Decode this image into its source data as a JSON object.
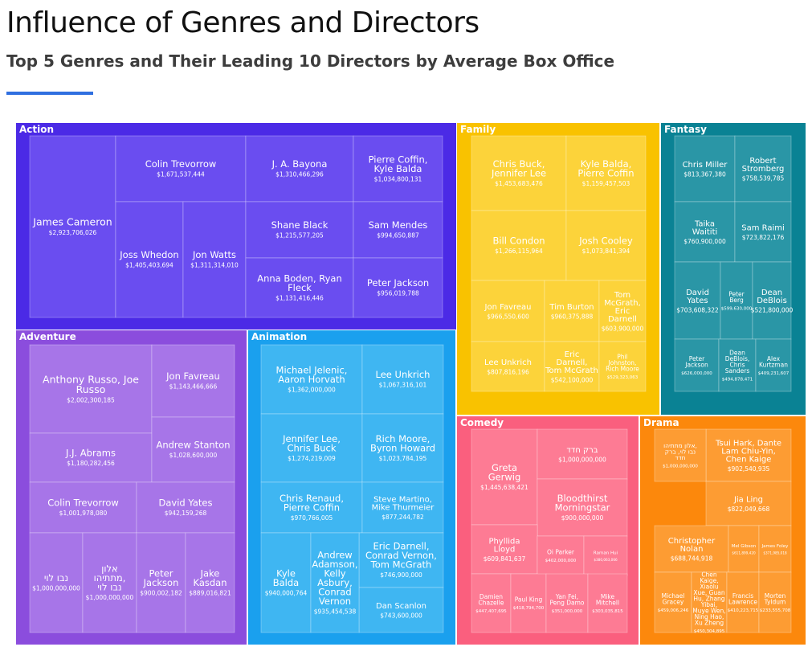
{
  "header": {
    "title": "Influence of Genres and Directors",
    "subtitle": "Top 5 Genres and Their Leading 10 Directors by Average Box Office",
    "accent_color": "#2f6fe0"
  },
  "chart_data": {
    "type": "treemap",
    "title": "Influence of Genres and Directors",
    "subtitle": "Top 5 Genres and Their Leading 10 Directors by Average Box Office",
    "genres": [
      {
        "name": "Action",
        "color": "#4b2ae6",
        "tile_color": "#6a4df0",
        "directors": [
          {
            "name": "James Cameron",
            "label": "$2,923,706,026",
            "value": 2923706026
          },
          {
            "name": "Colin Trevorrow",
            "label": "$1,671,537,444",
            "value": 1671537444
          },
          {
            "name": "Joss Whedon",
            "label": "$1,405,403,694",
            "value": 1405403694
          },
          {
            "name": "Jon Watts",
            "label": "$1,311,314,010",
            "value": 1311314010
          },
          {
            "name": "J. A. Bayona",
            "label": "$1,310,466,296",
            "value": 1310466296
          },
          {
            "name": "Shane Black",
            "label": "$1,215,577,205",
            "value": 1215577205
          },
          {
            "name": "Anna Boden, Ryan Fleck",
            "label": "$1,131,416,446",
            "value": 1131416446
          },
          {
            "name": "Pierre Coffin, Kyle Balda",
            "label": "$1,034,800,131",
            "value": 1034800131
          },
          {
            "name": "Sam Mendes",
            "label": "$994,650,887",
            "value": 994650887
          },
          {
            "name": "Peter Jackson",
            "label": "$956,019,788",
            "value": 956019788
          }
        ]
      },
      {
        "name": "Adventure",
        "color": "#8b4ddd",
        "tile_color": "#a775e8",
        "directors": [
          {
            "name": "Anthony Russo, Joe Russo",
            "label": "$2,002,300,185",
            "value": 2002300185
          },
          {
            "name": "Jon Favreau",
            "label": "$1,143,466,666",
            "value": 1143466666
          },
          {
            "name": "J.J. Abrams",
            "label": "$1,180,282,456",
            "value": 1180282456
          },
          {
            "name": "Andrew Stanton",
            "label": "$1,028,600,000",
            "value": 1028600000
          },
          {
            "name": "Colin Trevorrow",
            "label": "$1,001,978,080",
            "value": 1001978080
          },
          {
            "name": "David Yates",
            "label": "$942,159,268",
            "value": 942159268
          },
          {
            "name": "נבו לוי",
            "label": "$1,000,000,000",
            "value": 1000000000
          },
          {
            "name": "אלון מתתיהו, נבו לוי",
            "label": "$1,000,000,000",
            "value": 1000000000
          },
          {
            "name": "Peter Jackson",
            "label": "$900,002,182",
            "value": 900002182
          },
          {
            "name": "Jake Kasdan",
            "label": "$889,016,821",
            "value": 889016821
          }
        ]
      },
      {
        "name": "Animation",
        "color": "#1aa0ee",
        "tile_color": "#3fb6f2",
        "directors": [
          {
            "name": "Michael Jelenic, Aaron Horvath",
            "label": "$1,362,000,000",
            "value": 1362000000
          },
          {
            "name": "Lee Unkrich",
            "label": "$1,067,316,101",
            "value": 1067316101
          },
          {
            "name": "Jennifer Lee, Chris Buck",
            "label": "$1,274,219,009",
            "value": 1274219009
          },
          {
            "name": "Rich Moore, Byron Howard",
            "label": "$1,023,784,195",
            "value": 1023784195
          },
          {
            "name": "Chris Renaud, Pierre Coffin",
            "label": "$970,766,005",
            "value": 970766005
          },
          {
            "name": "Steve Martino, Mike Thurmeier",
            "label": "$877,244,782",
            "value": 877244782
          },
          {
            "name": "Eric Darnell, Conrad Vernon, Tom McGrath",
            "label": "$746,900,000",
            "value": 746900000
          },
          {
            "name": "Dan Scanlon",
            "label": "$743,600,000",
            "value": 743600000
          },
          {
            "name": "Kyle Balda",
            "label": "$940,000,764",
            "value": 940000764
          },
          {
            "name": "Andrew Adamson, Kelly Asbury, Conrad Vernon",
            "label": "$935,454,538",
            "value": 935454538
          }
        ]
      },
      {
        "name": "Family",
        "color": "#f9c200",
        "tile_color": "#fcd33a",
        "directors": [
          {
            "name": "Chris Buck, Jennifer Lee",
            "label": "$1,453,683,476",
            "value": 1453683476
          },
          {
            "name": "Kyle Balda, Pierre Coffin",
            "label": "$1,159,457,503",
            "value": 1159457503
          },
          {
            "name": "Bill Condon",
            "label": "$1,266,115,964",
            "value": 1266115964
          },
          {
            "name": "Josh Cooley",
            "label": "$1,073,841,394",
            "value": 1073841394
          },
          {
            "name": "Jon Favreau",
            "label": "$966,550,600",
            "value": 966550600
          },
          {
            "name": "Tim Burton",
            "label": "$960,375,888",
            "value": 960375888
          },
          {
            "name": "Tom McGrath, Eric Darnell",
            "label": "$603,900,000",
            "value": 603900000
          },
          {
            "name": "Lee Unkrich",
            "label": "$807,816,196",
            "value": 807816196
          },
          {
            "name": "Eric Darnell, Tom McGrath",
            "label": "$542,100,000",
            "value": 542100000
          },
          {
            "name": "Phil Johnston, Rich Moore",
            "label": "$529,323,063",
            "value": 529323063
          }
        ]
      },
      {
        "name": "Fantasy",
        "color": "#0a8294",
        "tile_color": "#2a96a6",
        "directors": [
          {
            "name": "Chris Miller",
            "label": "$813,367,380",
            "value": 813367380
          },
          {
            "name": "Robert Stromberg",
            "label": "$758,539,785",
            "value": 758539785
          },
          {
            "name": "Taika Waititi",
            "label": "$760,900,000",
            "value": 760900000
          },
          {
            "name": "Sam Raimi",
            "label": "$723,822,176",
            "value": 723822176
          },
          {
            "name": "David Yates",
            "label": "$703,608,322",
            "value": 703608322
          },
          {
            "name": "Peter Berg",
            "label": "$599,630,000",
            "value": 599630000
          },
          {
            "name": "Dean DeBlois",
            "label": "$521,800,000",
            "value": 521800000
          },
          {
            "name": "Peter Jackson",
            "label": "$626,000,000",
            "value": 626000000
          },
          {
            "name": "Dean DeBlois, Chris Sanders",
            "label": "$494,878,471",
            "value": 494878471
          },
          {
            "name": "Alex Kurtzman",
            "label": "$409,231,607",
            "value": 409231607
          }
        ]
      },
      {
        "name": "Comedy",
        "color": "#fa5f7e",
        "tile_color": "#fd7b94",
        "directors": [
          {
            "name": "Greta Gerwig",
            "label": "$1,445,638,421",
            "value": 1445638421
          },
          {
            "name": "ברק חדד",
            "label": "$1,000,000,000",
            "value": 1000000000
          },
          {
            "name": "Bloodthirst Morningstar",
            "label": "$900,000,000",
            "value": 900000000
          },
          {
            "name": "Phyllida Lloyd",
            "label": "$609,841,637",
            "value": 609841637
          },
          {
            "name": "Oi Parker",
            "label": "$402,000,000",
            "value": 402000000
          },
          {
            "name": "Raman Hui",
            "label": "$380,063,066",
            "value": 380063066
          },
          {
            "name": "Damien Chazelle",
            "label": "$447,407,695",
            "value": 447407695
          },
          {
            "name": "Paul King",
            "label": "$418,794,700",
            "value": 418794700
          },
          {
            "name": "Yan Fei, Peng Damo",
            "label": "$351,000,000",
            "value": 351000000
          },
          {
            "name": "Mike Mitchell",
            "label": "$303,035,815",
            "value": 303035815
          }
        ]
      },
      {
        "name": "Drama",
        "color": "#fc880c",
        "tile_color": "#fd9c33",
        "directors": [
          {
            "name": "Tsui Hark, Dante Lam Chiu-Yin, Chen Kaige",
            "label": "$902,540,935",
            "value": 902540935
          },
          {
            "name": "אלון מתתיהו, נבו לוי, ברק חדד",
            "label": "$1,000,000,000",
            "value": 1000000000
          },
          {
            "name": "Jia Ling",
            "label": "$822,049,668",
            "value": 822049668
          },
          {
            "name": "Christopher Nolan",
            "label": "$688,744,918",
            "value": 688744918
          },
          {
            "name": "Mel Gibson",
            "label": "$611,899,420",
            "value": 611899420
          },
          {
            "name": "James Foley",
            "label": "$371,985,018",
            "value": 371985018
          },
          {
            "name": "Michael Gracey",
            "label": "$459,006,246",
            "value": 459006246
          },
          {
            "name": "Chen Kaige, Xiaolu Xue, Guan Hu, Zhang Yibai, Muye Wen, Ning Hao, Xu Zheng",
            "label": "$450,304,895",
            "value": 450304895
          },
          {
            "name": "Francis Lawrence",
            "label": "$410,223,715",
            "value": 410223715
          },
          {
            "name": "Morten Tyldum",
            "label": "$233,555,708",
            "value": 233555708
          }
        ]
      }
    ]
  }
}
